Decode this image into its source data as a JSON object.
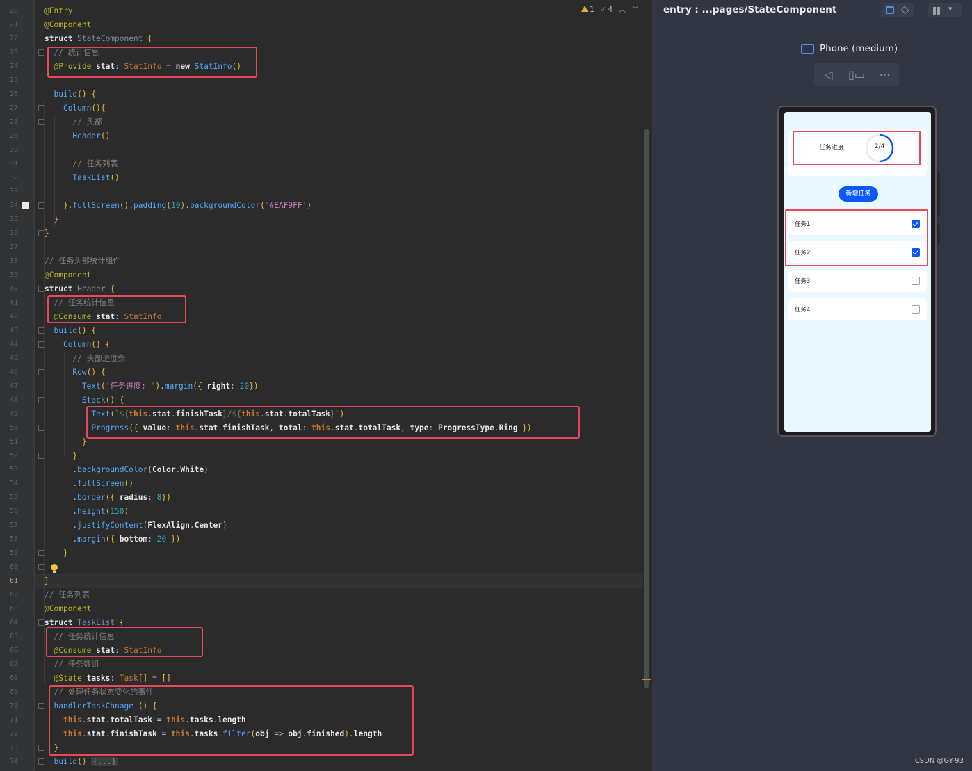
{
  "editor": {
    "line_numbers": [
      "20",
      "21",
      "22",
      "23",
      "24",
      "25",
      "26",
      "27",
      "28",
      "29",
      "30",
      "31",
      "32",
      "33",
      "34",
      "35",
      "36",
      "37",
      "38",
      "39",
      "40",
      "41",
      "42",
      "43",
      "44",
      "45",
      "46",
      "47",
      "48",
      "49",
      "50",
      "51",
      "52",
      "53",
      "54",
      "55",
      "56",
      "57",
      "58",
      "59",
      "60",
      "61",
      "62",
      "63",
      "64",
      "65",
      "66",
      "67",
      "68",
      "69",
      "70",
      "71",
      "72",
      "73",
      "74"
    ],
    "current_line": "61",
    "inspections": {
      "warnings": "1",
      "ok": "4"
    },
    "code": [
      [
        [
          "t-ann",
          "@Entry"
        ]
      ],
      [
        [
          "t-ann",
          "@Component"
        ]
      ],
      [
        [
          "t-kw",
          "struct "
        ],
        [
          "t-struct",
          "StateComponent "
        ],
        [
          "t-brk",
          "{"
        ]
      ],
      [
        [
          "t-pl",
          "  "
        ],
        [
          "t-cm",
          "// 统计信息"
        ]
      ],
      [
        [
          "t-pl",
          "  "
        ],
        [
          "t-ann",
          "@Provide "
        ],
        [
          "t-prop",
          "stat"
        ],
        [
          "t-pl",
          ": "
        ],
        [
          "t-type",
          "StatInfo"
        ],
        [
          "t-pl",
          " = "
        ],
        [
          "t-kw",
          "new "
        ],
        [
          "t-fn",
          "StatInfo"
        ],
        [
          "t-brk",
          "()"
        ]
      ],
      [],
      [
        [
          "t-pl",
          "  "
        ],
        [
          "t-fn",
          "build"
        ],
        [
          "t-brk",
          "() {"
        ]
      ],
      [
        [
          "t-pl",
          "    "
        ],
        [
          "t-fn",
          "Column"
        ],
        [
          "t-brk",
          "(){"
        ]
      ],
      [
        [
          "t-pl",
          "      "
        ],
        [
          "t-cm",
          "// 头部"
        ]
      ],
      [
        [
          "t-pl",
          "      "
        ],
        [
          "t-fn",
          "Header"
        ],
        [
          "t-brk",
          "()"
        ]
      ],
      [],
      [
        [
          "t-pl",
          "      "
        ],
        [
          "t-cm",
          "// 任务列表"
        ]
      ],
      [
        [
          "t-pl",
          "      "
        ],
        [
          "t-fn",
          "TaskList"
        ],
        [
          "t-brk",
          "()"
        ]
      ],
      [],
      [
        [
          "t-pl",
          "    "
        ],
        [
          "t-brk",
          "}"
        ],
        [
          "t-pl",
          "."
        ],
        [
          "t-fn",
          "fullScreen"
        ],
        [
          "t-brk",
          "()"
        ],
        [
          "t-pl",
          "."
        ],
        [
          "t-fn",
          "padding"
        ],
        [
          "t-brk",
          "("
        ],
        [
          "t-num",
          "10"
        ],
        [
          "t-brk",
          ")"
        ],
        [
          "t-pl",
          "."
        ],
        [
          "t-fn",
          "backgroundColor"
        ],
        [
          "t-brk",
          "("
        ],
        [
          "t-str",
          "'"
        ],
        [
          "t-strv",
          "#EAF9FF"
        ],
        [
          "t-str",
          "'"
        ],
        [
          "t-brk",
          ")"
        ]
      ],
      [
        [
          "t-pl",
          "  "
        ],
        [
          "t-brk",
          "}"
        ]
      ],
      [
        [
          "t-brk",
          "}"
        ]
      ],
      [],
      [
        [
          "t-cm",
          "// 任务头部统计组件"
        ]
      ],
      [
        [
          "t-ann",
          "@Component"
        ]
      ],
      [
        [
          "t-kw",
          "struct "
        ],
        [
          "t-struct",
          "Header "
        ],
        [
          "t-brk",
          "{"
        ]
      ],
      [
        [
          "t-pl",
          "  "
        ],
        [
          "t-cm",
          "// 任务统计信息"
        ]
      ],
      [
        [
          "t-pl",
          "  "
        ],
        [
          "t-ann",
          "@Consume "
        ],
        [
          "t-prop",
          "stat"
        ],
        [
          "t-pl",
          ": "
        ],
        [
          "t-type",
          "StatInfo"
        ]
      ],
      [
        [
          "t-pl",
          "  "
        ],
        [
          "t-fn",
          "build"
        ],
        [
          "t-brk",
          "() {"
        ]
      ],
      [
        [
          "t-pl",
          "    "
        ],
        [
          "t-fn",
          "Column"
        ],
        [
          "t-brk",
          "() {"
        ]
      ],
      [
        [
          "t-pl",
          "      "
        ],
        [
          "t-cm",
          "// 头部进度条"
        ]
      ],
      [
        [
          "t-pl",
          "      "
        ],
        [
          "t-fn",
          "Row"
        ],
        [
          "t-brk",
          "() {"
        ]
      ],
      [
        [
          "t-pl",
          "        "
        ],
        [
          "t-fn",
          "Text"
        ],
        [
          "t-brk",
          "("
        ],
        [
          "t-str",
          "'"
        ],
        [
          "t-strv",
          "任务进度: "
        ],
        [
          "t-str",
          "'"
        ],
        [
          "t-brk",
          ")"
        ],
        [
          "t-pl",
          "."
        ],
        [
          "t-fn",
          "margin"
        ],
        [
          "t-brk",
          "({ "
        ],
        [
          "t-prop",
          "right"
        ],
        [
          "t-pl",
          ": "
        ],
        [
          "t-num",
          "20"
        ],
        [
          "t-brk",
          "})"
        ]
      ],
      [
        [
          "t-pl",
          "        "
        ],
        [
          "t-fn",
          "Stack"
        ],
        [
          "t-brk",
          "() {"
        ]
      ],
      [
        [
          "t-pl",
          "          "
        ],
        [
          "t-fn",
          "Text"
        ],
        [
          "t-brk",
          "("
        ],
        [
          "t-str",
          "`${"
        ],
        [
          "t-this",
          "this"
        ],
        [
          "t-pl",
          "."
        ],
        [
          "t-prop",
          "stat"
        ],
        [
          "t-pl",
          "."
        ],
        [
          "t-prop",
          "finishTask"
        ],
        [
          "t-str",
          "}/${"
        ],
        [
          "t-this",
          "this"
        ],
        [
          "t-pl",
          "."
        ],
        [
          "t-prop",
          "stat"
        ],
        [
          "t-pl",
          "."
        ],
        [
          "t-prop",
          "totalTask"
        ],
        [
          "t-str",
          "}`"
        ],
        [
          "t-brk",
          ")"
        ]
      ],
      [
        [
          "t-pl",
          "          "
        ],
        [
          "t-fn",
          "Progress"
        ],
        [
          "t-brk",
          "({ "
        ],
        [
          "t-prop",
          "value"
        ],
        [
          "t-pl",
          ": "
        ],
        [
          "t-this",
          "this"
        ],
        [
          "t-pl",
          "."
        ],
        [
          "t-prop",
          "stat"
        ],
        [
          "t-pl",
          "."
        ],
        [
          "t-prop",
          "finishTask"
        ],
        [
          "t-pl",
          ", "
        ],
        [
          "t-prop",
          "total"
        ],
        [
          "t-pl",
          ": "
        ],
        [
          "t-this",
          "this"
        ],
        [
          "t-pl",
          "."
        ],
        [
          "t-prop",
          "stat"
        ],
        [
          "t-pl",
          "."
        ],
        [
          "t-prop",
          "totalTask"
        ],
        [
          "t-pl",
          ", "
        ],
        [
          "t-prop",
          "type"
        ],
        [
          "t-pl",
          ": "
        ],
        [
          "t-prop",
          "ProgressType"
        ],
        [
          "t-pl",
          "."
        ],
        [
          "t-prop",
          "Ring"
        ],
        [
          "t-brk",
          " })"
        ]
      ],
      [
        [
          "t-pl",
          "        "
        ],
        [
          "t-brk",
          "}"
        ]
      ],
      [
        [
          "t-pl",
          "      "
        ],
        [
          "t-brk",
          "}"
        ]
      ],
      [
        [
          "t-pl",
          "      ."
        ],
        [
          "t-fn",
          "backgroundColor"
        ],
        [
          "t-brk",
          "("
        ],
        [
          "t-prop",
          "Color"
        ],
        [
          "t-pl",
          "."
        ],
        [
          "t-prop",
          "White"
        ],
        [
          "t-brk",
          ")"
        ]
      ],
      [
        [
          "t-pl",
          "      ."
        ],
        [
          "t-fn",
          "fullScreen"
        ],
        [
          "t-brk",
          "()"
        ]
      ],
      [
        [
          "t-pl",
          "      ."
        ],
        [
          "t-fn",
          "border"
        ],
        [
          "t-brk",
          "({ "
        ],
        [
          "t-prop",
          "radius"
        ],
        [
          "t-pl",
          ": "
        ],
        [
          "t-num",
          "8"
        ],
        [
          "t-brk",
          "})"
        ]
      ],
      [
        [
          "t-pl",
          "      ."
        ],
        [
          "t-fn",
          "height"
        ],
        [
          "t-brk",
          "("
        ],
        [
          "t-num",
          "150"
        ],
        [
          "t-brk",
          ")"
        ]
      ],
      [
        [
          "t-pl",
          "      ."
        ],
        [
          "t-fn",
          "justifyContent"
        ],
        [
          "t-brk",
          "("
        ],
        [
          "t-prop",
          "FlexAlign"
        ],
        [
          "t-pl",
          "."
        ],
        [
          "t-prop",
          "Center"
        ],
        [
          "t-brk",
          ")"
        ]
      ],
      [
        [
          "t-pl",
          "      ."
        ],
        [
          "t-fn",
          "margin"
        ],
        [
          "t-brk",
          "({ "
        ],
        [
          "t-prop",
          "bottom"
        ],
        [
          "t-pl",
          ": "
        ],
        [
          "t-num",
          "20"
        ],
        [
          "t-brk",
          " })"
        ]
      ],
      [
        [
          "t-pl",
          "    "
        ],
        [
          "t-brk",
          "}"
        ]
      ],
      [
        [
          "t-pl",
          "  "
        ],
        [
          "t-brk",
          ""
        ]
      ],
      [
        [
          "t-brk",
          "}"
        ]
      ],
      [
        [
          "t-cm",
          "// 任务列表"
        ]
      ],
      [
        [
          "t-ann",
          "@Component"
        ]
      ],
      [
        [
          "t-kw",
          "struct "
        ],
        [
          "t-struct",
          "TaskList "
        ],
        [
          "t-brk",
          "{"
        ]
      ],
      [
        [
          "t-pl",
          "  "
        ],
        [
          "t-cm",
          "// 任务统计信息"
        ]
      ],
      [
        [
          "t-pl",
          "  "
        ],
        [
          "t-ann",
          "@Consume "
        ],
        [
          "t-prop",
          "stat"
        ],
        [
          "t-pl",
          ": "
        ],
        [
          "t-type",
          "StatInfo"
        ]
      ],
      [
        [
          "t-pl",
          "  "
        ],
        [
          "t-cm",
          "// 任务数组"
        ]
      ],
      [
        [
          "t-pl",
          "  "
        ],
        [
          "t-ann",
          "@State "
        ],
        [
          "t-prop",
          "tasks"
        ],
        [
          "t-pl",
          ": "
        ],
        [
          "t-type",
          "Task"
        ],
        [
          "t-brk",
          "[]"
        ],
        [
          "t-pl",
          " = "
        ],
        [
          "t-brk",
          "[]"
        ]
      ],
      [
        [
          "t-pl",
          "  "
        ],
        [
          "t-cm",
          "// 处理任务状态变化的事件"
        ]
      ],
      [
        [
          "t-pl",
          "  "
        ],
        [
          "t-fn",
          "handlerTaskChnage "
        ],
        [
          "t-brk",
          "() {"
        ]
      ],
      [
        [
          "t-pl",
          "    "
        ],
        [
          "t-this",
          "this"
        ],
        [
          "t-pl",
          "."
        ],
        [
          "t-prop",
          "stat"
        ],
        [
          "t-pl",
          "."
        ],
        [
          "t-prop",
          "totalTask"
        ],
        [
          "t-pl",
          " = "
        ],
        [
          "t-this",
          "this"
        ],
        [
          "t-pl",
          "."
        ],
        [
          "t-prop",
          "tasks"
        ],
        [
          "t-pl",
          "."
        ],
        [
          "t-prop",
          "length"
        ]
      ],
      [
        [
          "t-pl",
          "    "
        ],
        [
          "t-this",
          "this"
        ],
        [
          "t-pl",
          "."
        ],
        [
          "t-prop",
          "stat"
        ],
        [
          "t-pl",
          "."
        ],
        [
          "t-prop",
          "finishTask"
        ],
        [
          "t-pl",
          " = "
        ],
        [
          "t-this",
          "this"
        ],
        [
          "t-pl",
          "."
        ],
        [
          "t-prop",
          "tasks"
        ],
        [
          "t-pl",
          "."
        ],
        [
          "t-fn",
          "filter"
        ],
        [
          "t-brk",
          "("
        ],
        [
          "t-prop",
          "obj"
        ],
        [
          "t-pl",
          " => "
        ],
        [
          "t-prop",
          "obj"
        ],
        [
          "t-pl",
          "."
        ],
        [
          "t-prop",
          "finished"
        ],
        [
          "t-brk",
          ")"
        ],
        [
          "t-pl",
          "."
        ],
        [
          "t-prop",
          "length"
        ]
      ],
      [
        [
          "t-pl",
          "  "
        ],
        [
          "t-brk",
          "}"
        ]
      ],
      [
        [
          "t-pl",
          "  "
        ],
        [
          "t-fn",
          "build"
        ],
        [
          "t-brk",
          "() "
        ],
        [
          "t-fold",
          "{...}"
        ]
      ]
    ]
  },
  "preview": {
    "title": "entry : ...pages/StateComponent",
    "device": "Phone (medium)",
    "app": {
      "stat_label": "任务进度:",
      "progress_text": "2/4",
      "progress": {
        "value": 2,
        "total": 4
      },
      "add_button": "新增任务",
      "tasks": [
        {
          "name": "任务1",
          "finished": true
        },
        {
          "name": "任务2",
          "finished": true
        },
        {
          "name": "任务3",
          "finished": false
        },
        {
          "name": "任务4",
          "finished": false
        }
      ]
    }
  },
  "watermark": "CSDN @GY-93",
  "colors": {
    "highlight": "#e8495a",
    "accent": "#0a59f7",
    "app_bg": "#eaf9ff"
  }
}
